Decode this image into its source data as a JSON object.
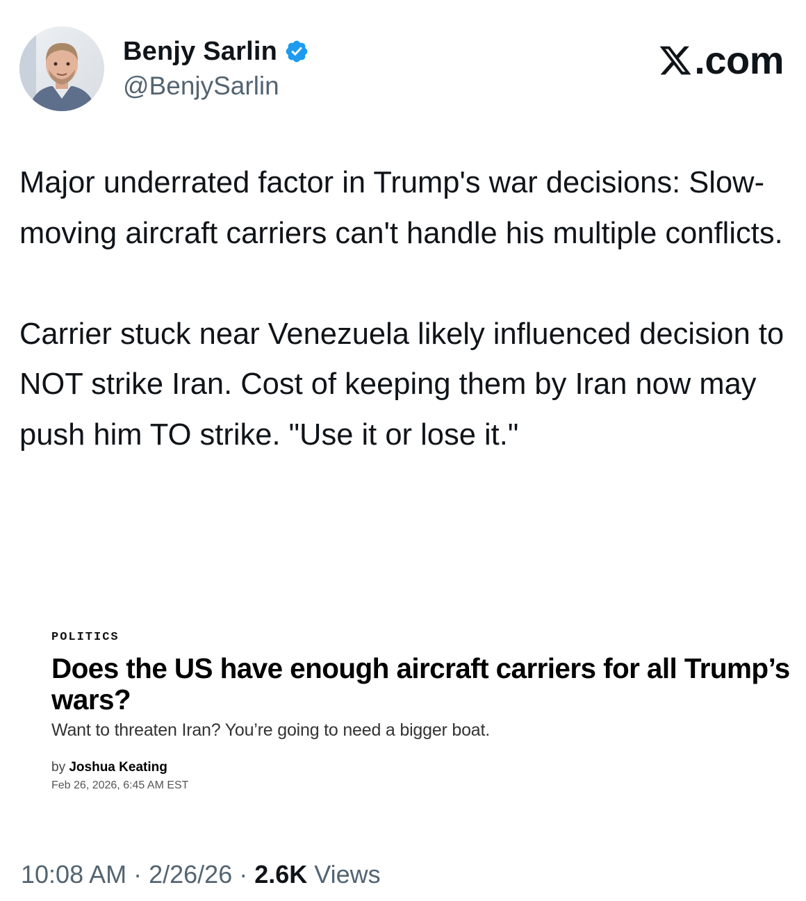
{
  "author": {
    "display_name": "Benjy Sarlin",
    "handle": "@BenjySarlin",
    "verified": true,
    "verified_color": "#1d9bf0"
  },
  "brand": {
    "label": ".com"
  },
  "tweet": {
    "paragraphs": [
      "Major underrated factor in Trump's war decisions: Slow-moving aircraft carriers can't handle his multiple conflicts.",
      "Carrier stuck near Venezuela likely influenced decision to NOT strike Iran. Cost of keeping them by Iran now may push him TO strike. \"Use it or lose it.\""
    ]
  },
  "article": {
    "kicker": "POLITICS",
    "headline": "Does the US have enough aircraft carriers for all Trump’s wars?",
    "dek": "Want to threaten Iran? You’re going to need a bigger boat.",
    "byline_prefix": "by",
    "author": "Joshua Keating",
    "dateline": "Feb 26, 2026, 6:45 AM EST"
  },
  "meta": {
    "time": "10:08 AM",
    "separator": "·",
    "date": "2/26/26",
    "views_count": "2.6K",
    "views_label": "Views"
  },
  "icons": {
    "verified": "verified-badge-icon",
    "brand": "x-logo-icon"
  }
}
